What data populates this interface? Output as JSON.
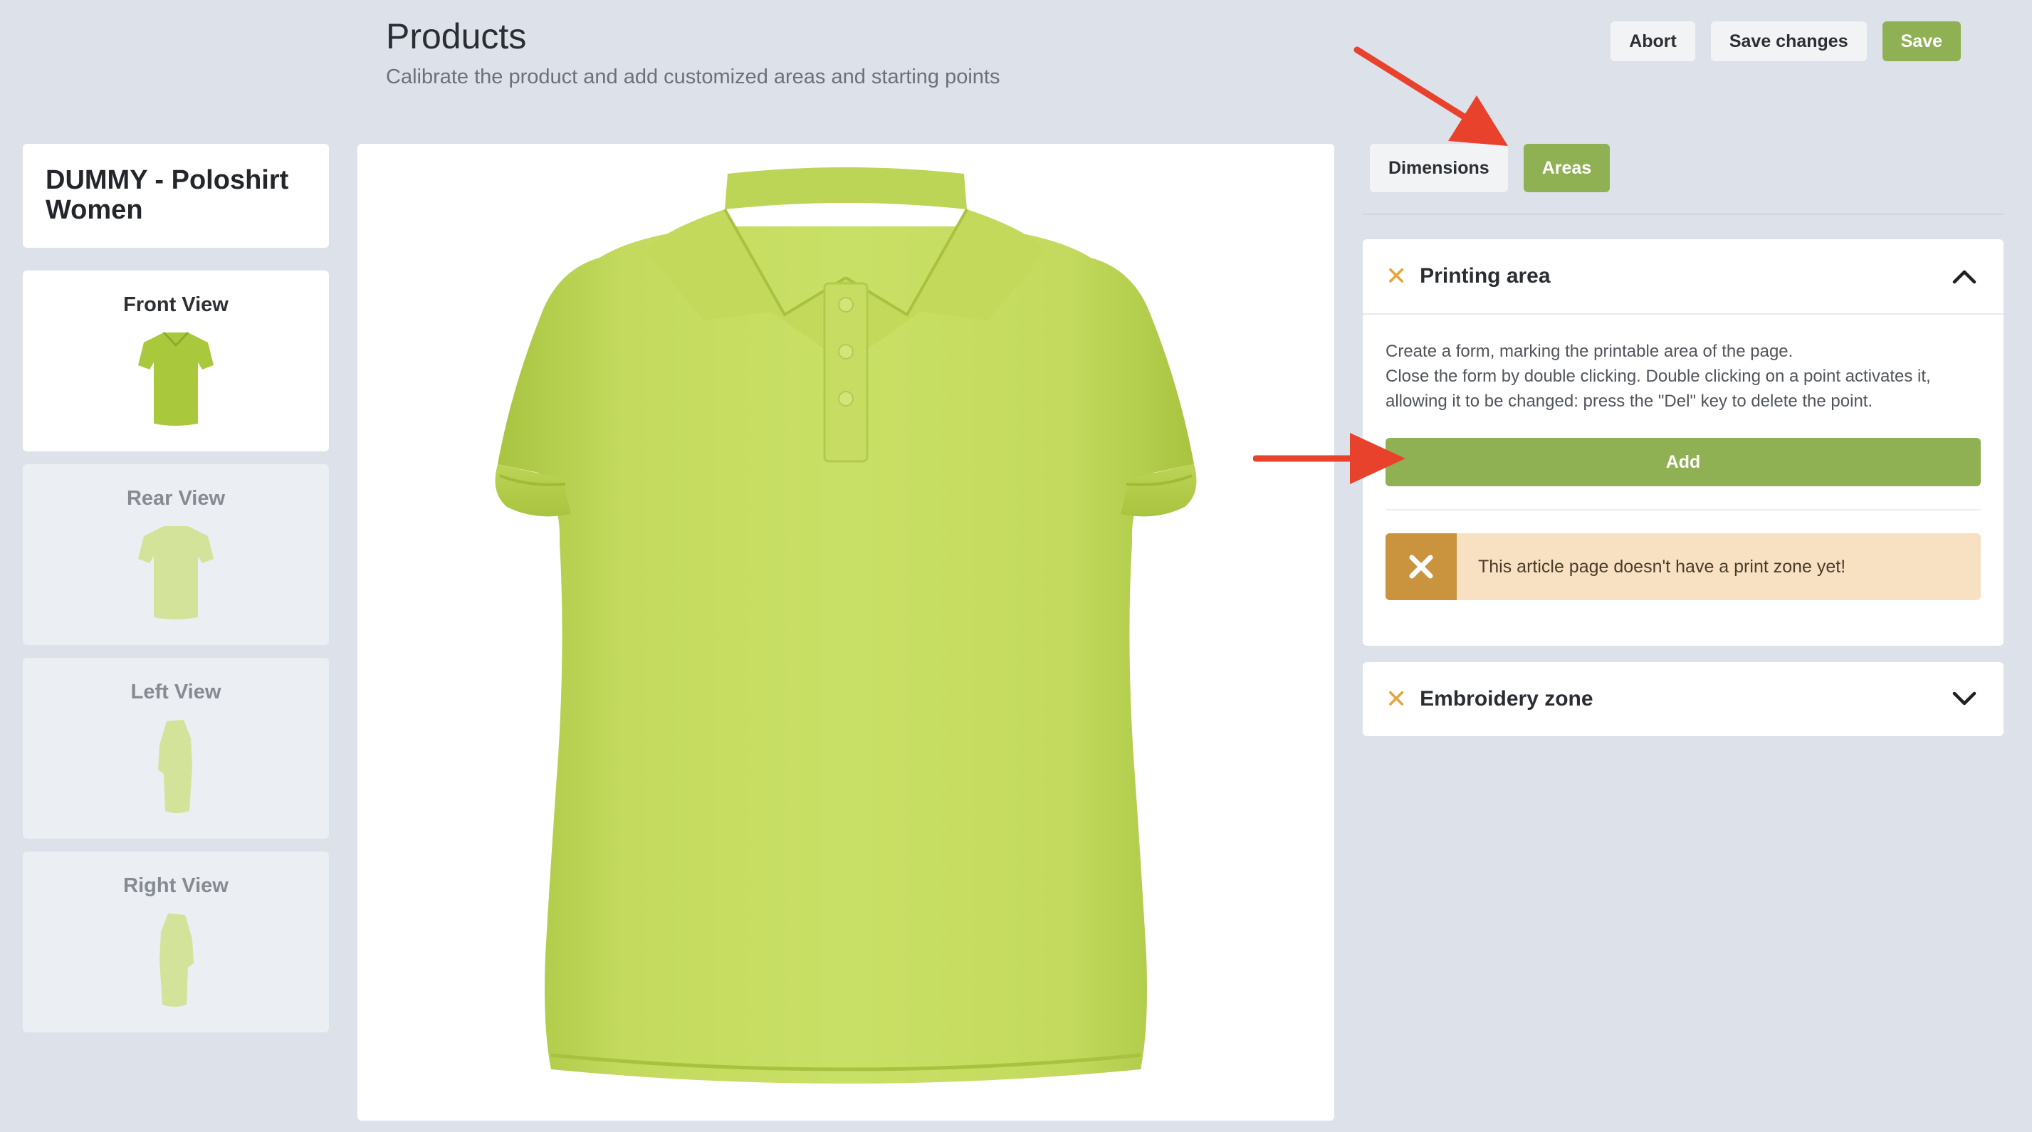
{
  "header": {
    "title": "Products",
    "subtitle": "Calibrate the product and add customized areas and starting points"
  },
  "actions": {
    "abort_label": "Abort",
    "save_changes_label": "Save changes",
    "save_label": "Save"
  },
  "product": {
    "name": "DUMMY - Poloshirt Women",
    "color": "#c5dc62"
  },
  "views": [
    {
      "label": "Front View",
      "active": true
    },
    {
      "label": "Rear View",
      "active": false
    },
    {
      "label": "Left View",
      "active": false
    },
    {
      "label": "Right View",
      "active": false
    }
  ],
  "tabs": [
    {
      "label": "Dimensions",
      "active": false
    },
    {
      "label": "Areas",
      "active": true
    }
  ],
  "printing_area": {
    "title": "Printing area",
    "description_lines": [
      "Create a form, marking the printable area of the page.",
      "Close the form by double clicking. Double clicking on a point activates it,",
      "allowing it to be changed: press the \"Del\" key to delete the point."
    ],
    "add_label": "Add",
    "alert_text": "This article page doesn't have a print zone yet!",
    "expanded": true
  },
  "embroidery_zone": {
    "title": "Embroidery zone",
    "expanded": false
  },
  "colors": {
    "accent_green": "#8fb154",
    "warning_orange": "#e8a33a",
    "alert_bg": "#f8e1c2",
    "alert_icon_bg": "#c9943d",
    "annotation_arrow": "#e8412c"
  },
  "icons": {
    "chevron_up": "chevron-up-icon",
    "chevron_down": "chevron-down-icon",
    "close": "close-icon"
  }
}
